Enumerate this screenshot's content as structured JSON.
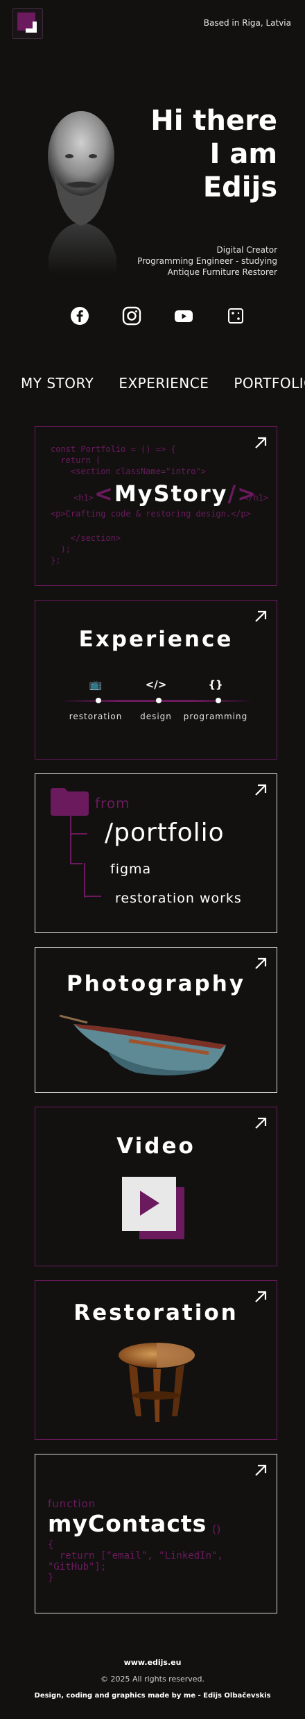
{
  "header": {
    "location": "Based in Riga, Latvia"
  },
  "hero": {
    "title_line1": "Hi there",
    "title_line2": "I am",
    "title_line3": "Edijs",
    "roles": [
      "Digital Creator",
      "Programming Engineer - studying",
      "Antique Furniture Restorer"
    ]
  },
  "social": [
    "facebook-icon",
    "instagram-icon",
    "youtube-icon",
    "dice-icon"
  ],
  "nav": [
    "MY STORY",
    "EXPERIENCE",
    "PORTFOLIO"
  ],
  "mystory": {
    "code_top": "const Portfolio = () => {\n  return (\n    <section className=\"intro\">",
    "h1_open": "<h1>",
    "bracket_left": "<",
    "title": "MyStory",
    "bracket_right": "/>",
    "h1_close": "</h1>",
    "tagline": "<p>Crafting code & restoring design.</p>",
    "code_bottom": "    </section>\n  );\n};"
  },
  "experience": {
    "title": "Experience",
    "items": [
      {
        "icon": "📺",
        "label": "restoration"
      },
      {
        "icon": "</>",
        "label": "design"
      },
      {
        "icon": "{}",
        "label": "programming"
      }
    ]
  },
  "portfolio": {
    "from": "from",
    "title": "/portfolio",
    "child1": "figma",
    "child2": "restoration works"
  },
  "photography": {
    "title": "Photography"
  },
  "video": {
    "title": "Video"
  },
  "restoration": {
    "title": "Restoration"
  },
  "contacts": {
    "keyword": "function",
    "title": "myContacts",
    "paren": "()",
    "body": "{\n  return [\"email\", \"LinkedIn\",\n\"GitHub\"];\n}"
  },
  "footer": {
    "site": "www.edijs.eu",
    "copyright": "© 2025 All rights reserved.",
    "credit": "Design, coding and graphics made by me - Edijs Olbačevskis"
  },
  "colors": {
    "accent": "#6b1a5e",
    "background": "#121110",
    "text": "#ffffff"
  }
}
